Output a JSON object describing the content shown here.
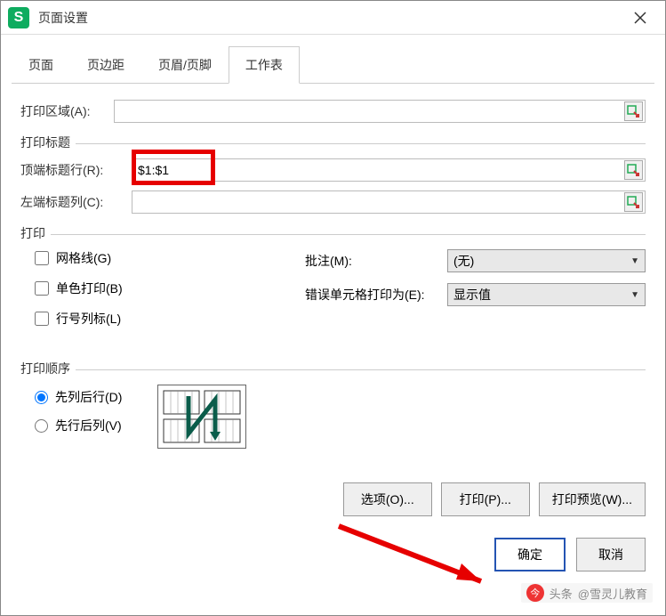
{
  "window": {
    "title": "页面设置",
    "app_icon_letter": "S"
  },
  "tabs": {
    "items": [
      {
        "label": "页面"
      },
      {
        "label": "页边距"
      },
      {
        "label": "页眉/页脚"
      },
      {
        "label": "工作表"
      }
    ],
    "active_index": 3
  },
  "print_area": {
    "label": "打印区域(A):",
    "value": ""
  },
  "print_title": {
    "section_label": "打印标题",
    "top_row": {
      "label": "顶端标题行(R):",
      "value": "$1:$1"
    },
    "left_col": {
      "label": "左端标题列(C):",
      "value": ""
    }
  },
  "print_options": {
    "section_label": "打印",
    "gridlines": {
      "label": "网格线(G)",
      "checked": false
    },
    "monochrome": {
      "label": "单色打印(B)",
      "checked": false
    },
    "row_col_headers": {
      "label": "行号列标(L)",
      "checked": false
    },
    "comments": {
      "label": "批注(M):",
      "value": "(无)"
    },
    "errors": {
      "label": "错误单元格打印为(E):",
      "value": "显示值"
    }
  },
  "print_order": {
    "section_label": "打印顺序",
    "down_then_over": {
      "label": "先列后行(D)",
      "checked": true
    },
    "over_then_down": {
      "label": "先行后列(V)",
      "checked": false
    }
  },
  "buttons": {
    "options": "选项(O)...",
    "print": "打印(P)...",
    "preview": "打印预览(W)...",
    "ok": "确定",
    "cancel": "取消"
  },
  "watermark": {
    "source": "头条",
    "author": "@雪灵儿教育"
  }
}
